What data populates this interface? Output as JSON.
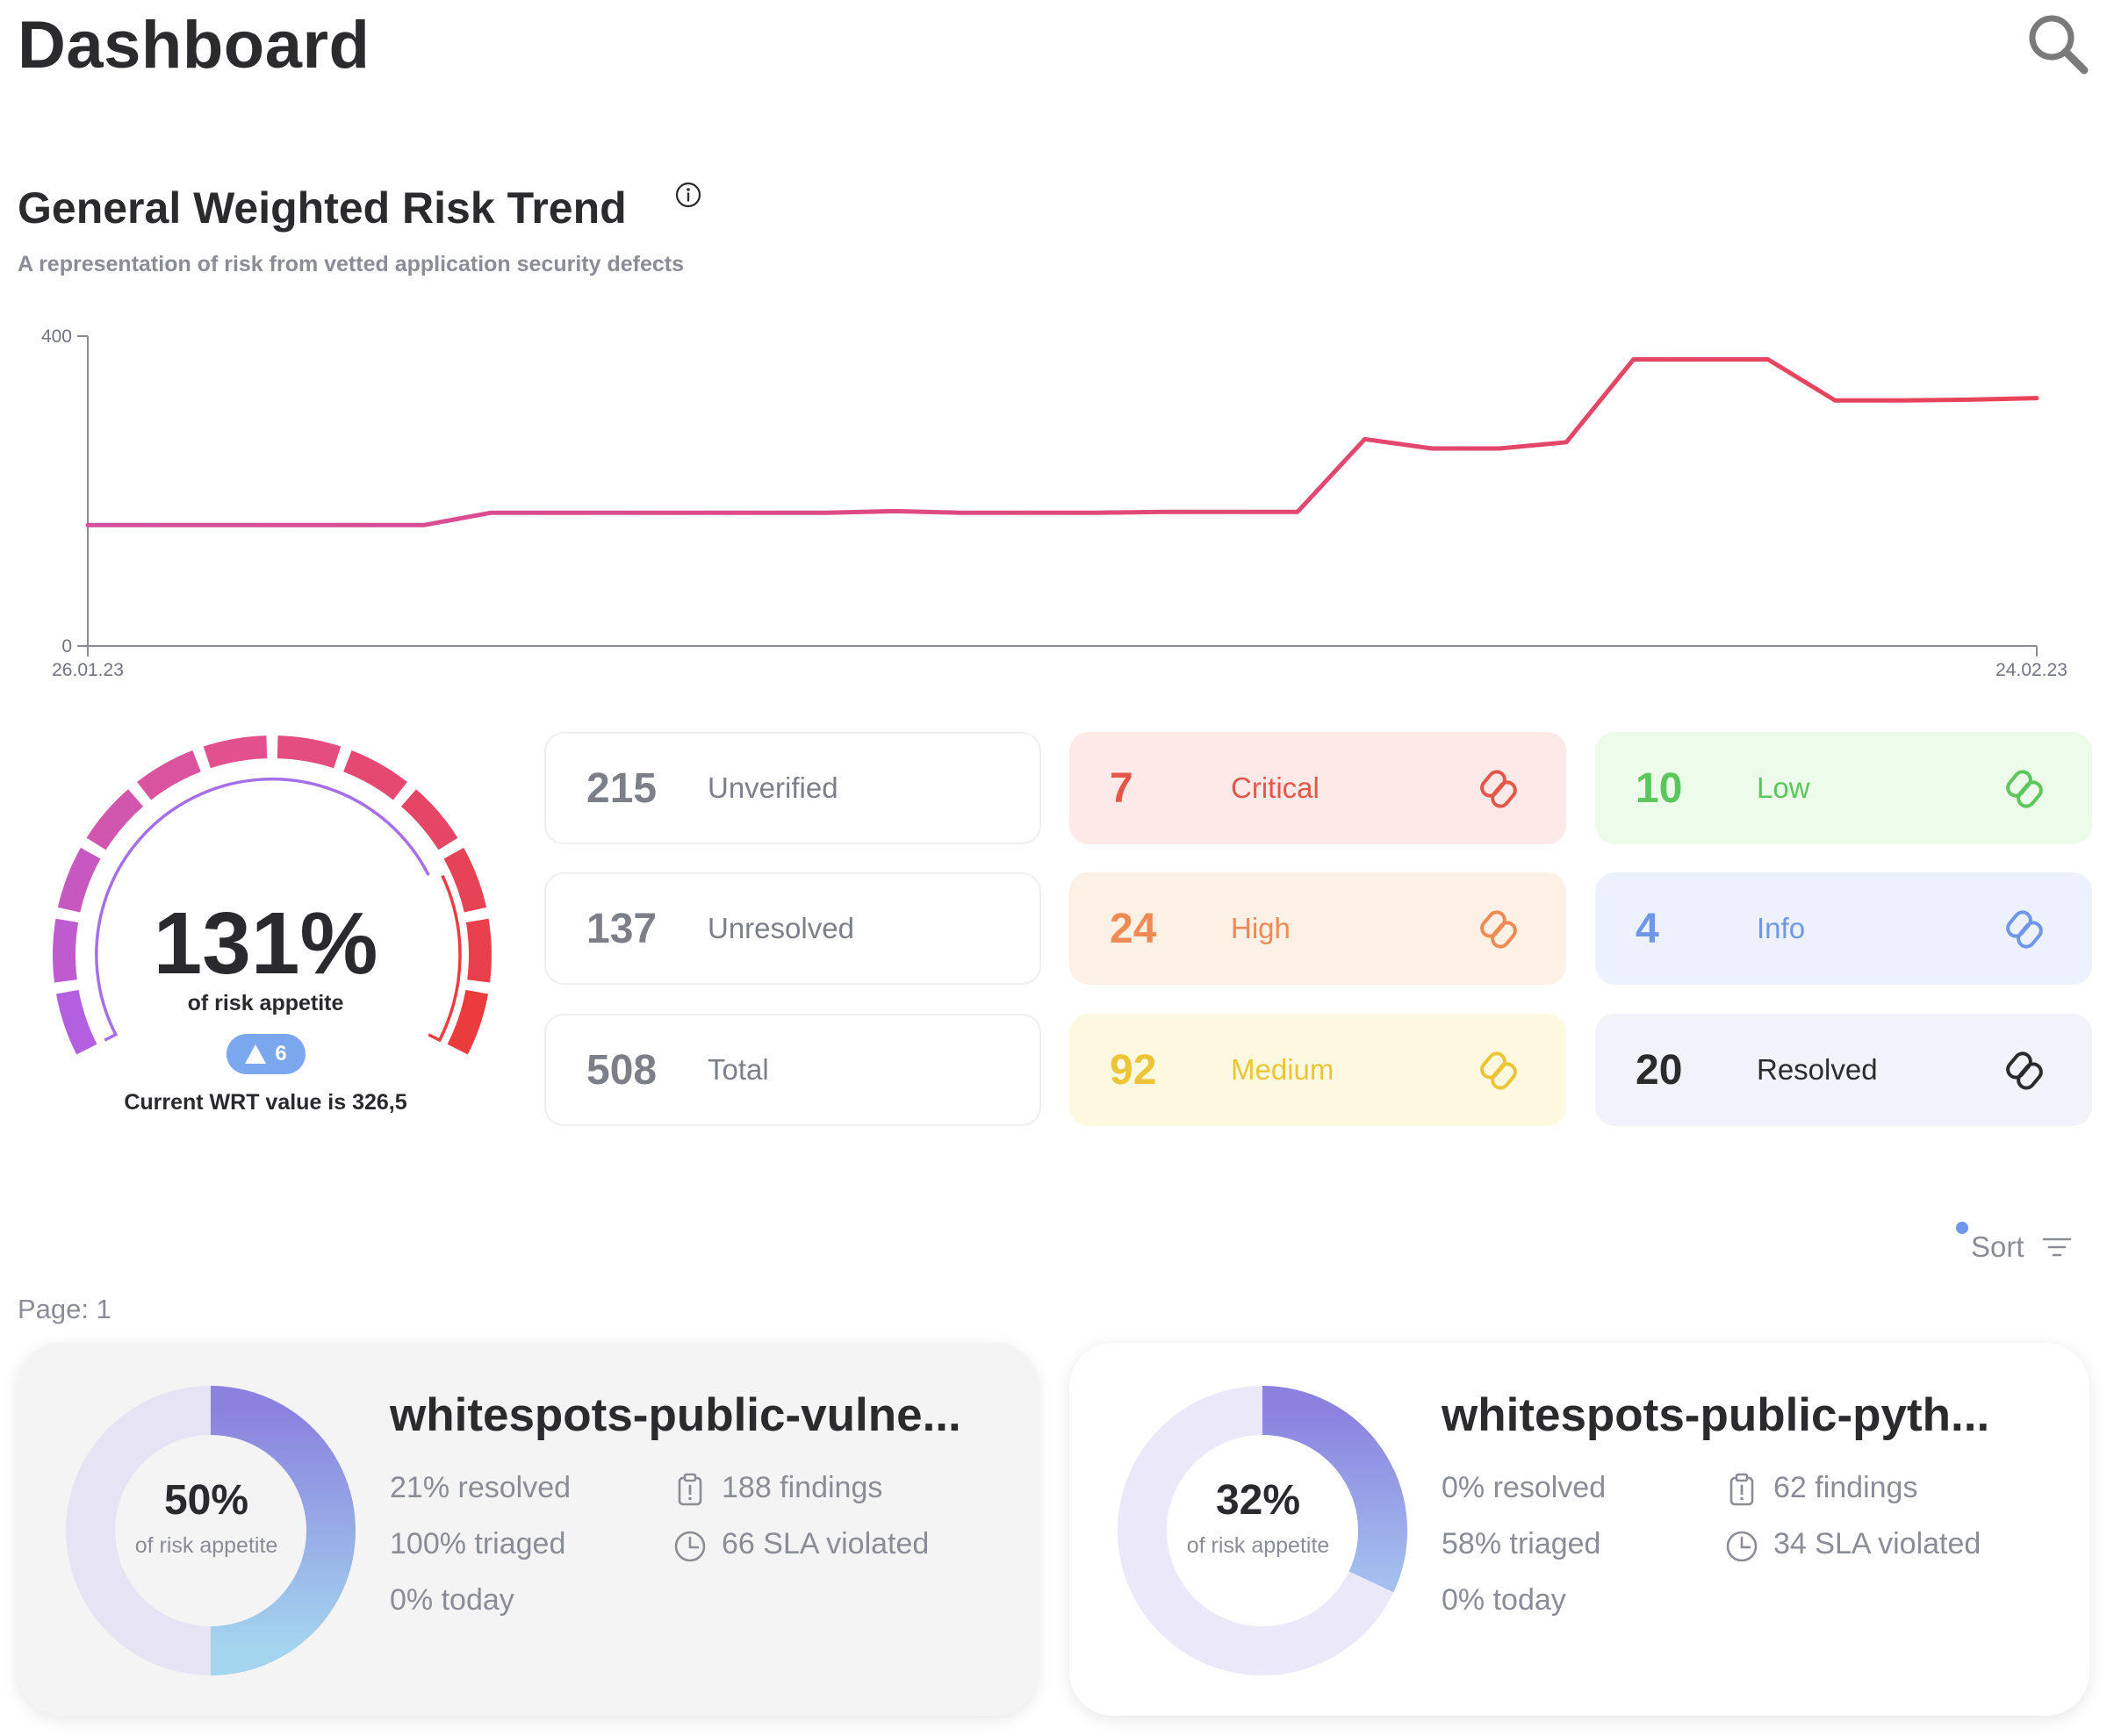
{
  "header": {
    "title": "Dashboard",
    "search_icon": "search-icon"
  },
  "trend": {
    "title": "General Weighted Risk Trend",
    "info_icon": "info-icon",
    "subtitle": "A representation of risk from vetted application security defects"
  },
  "chart_data": {
    "type": "line",
    "title": "",
    "xlabel": "",
    "ylabel": "",
    "x_tick_labels": [
      "26.01.23",
      "24.02.23"
    ],
    "ylim": [
      0,
      400
    ],
    "y_ticks": [
      0,
      400
    ],
    "grid": false,
    "legend": "none",
    "line_colors": [
      "#d64fa0",
      "#e84356"
    ],
    "series": [
      {
        "x": [
          "26.01.23",
          "27.01.23",
          "28.01.23",
          "29.01.23",
          "30.01.23",
          "31.01.23",
          "01.02.23",
          "02.02.23",
          "03.02.23",
          "04.02.23",
          "05.02.23",
          "06.02.23",
          "07.02.23",
          "08.02.23",
          "09.02.23",
          "10.02.23",
          "11.02.23",
          "12.02.23",
          "13.02.23",
          "14.02.23",
          "15.02.23",
          "16.02.23",
          "17.02.23",
          "18.02.23",
          "19.02.23",
          "20.02.23",
          "21.02.23",
          "22.02.23",
          "23.02.23",
          "24.02.23"
        ],
        "values": [
          156,
          156,
          156,
          156,
          156,
          156,
          172,
          172,
          172,
          172,
          172,
          172,
          174,
          172,
          172,
          172,
          173,
          173,
          173,
          267,
          255,
          255,
          263,
          370,
          370,
          370,
          317,
          317,
          318,
          320
        ]
      }
    ]
  },
  "gauge": {
    "value": "131%",
    "caption": "of risk appetite",
    "delta": "6",
    "current": "Current WRT value is 326,5",
    "ratio": 1.31
  },
  "stats": {
    "unverified": {
      "value": "215",
      "label": "Unverified"
    },
    "unresolved": {
      "value": "137",
      "label": "Unresolved"
    },
    "total": {
      "value": "508",
      "label": "Total"
    },
    "critical": {
      "value": "7",
      "label": "Critical",
      "color": "#e5564a",
      "bg": "#fde9e7"
    },
    "high": {
      "value": "24",
      "label": "High",
      "color": "#ef8a55",
      "bg": "#fdf0e5"
    },
    "medium": {
      "value": "92",
      "label": "Medium",
      "color": "#ebc535",
      "bg": "#fdf9e0"
    },
    "low": {
      "value": "10",
      "label": "Low",
      "color": "#5bc65c",
      "bg": "#ecfbea"
    },
    "info": {
      "value": "4",
      "label": "Info",
      "color": "#6f97e6",
      "bg": "#edf1fd"
    },
    "resolved": {
      "value": "20",
      "label": "Resolved",
      "color": "#2b2b2e",
      "bg": "#f2f2fb"
    }
  },
  "list": {
    "sort_label": "Sort",
    "page_label": "Page: 1"
  },
  "apps": [
    {
      "name": "whitespots-public-vulne...",
      "percent": "50%",
      "fraction": 0.5,
      "caption": "of risk appetite",
      "resolved": "21% resolved",
      "triaged": "100% triaged",
      "today": "0% today",
      "findings": "188 findings",
      "sla": "66 SLA violated",
      "bg": "#f4f4f4"
    },
    {
      "name": "whitespots-public-pyth...",
      "percent": "32%",
      "fraction": 0.32,
      "caption": "of risk appetite",
      "resolved": "0% resolved",
      "triaged": "58% triaged",
      "today": "0% today",
      "findings": "62 findings",
      "sla": "34 SLA violated",
      "bg": "#ffffff"
    }
  ]
}
